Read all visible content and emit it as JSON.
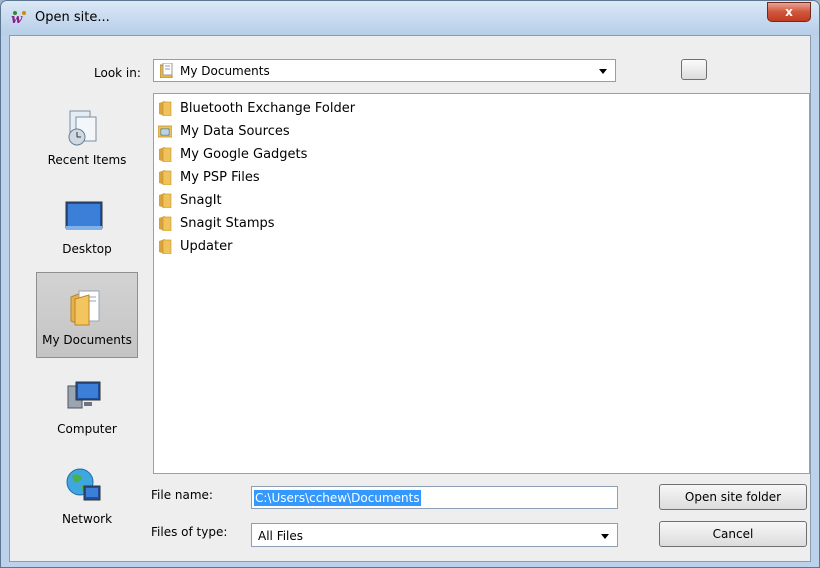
{
  "window": {
    "title": "Open site...",
    "close_symbol": "x"
  },
  "lookin": {
    "label": "Look in:",
    "value": "My Documents"
  },
  "places": [
    {
      "label": "Recent Items",
      "icon": "recent-items-icon",
      "selected": false
    },
    {
      "label": "Desktop",
      "icon": "desktop-icon",
      "selected": false
    },
    {
      "label": "My Documents",
      "icon": "my-documents-icon",
      "selected": true
    },
    {
      "label": "Computer",
      "icon": "computer-icon",
      "selected": false
    },
    {
      "label": "Network",
      "icon": "network-icon",
      "selected": false
    }
  ],
  "files": [
    {
      "name": "Bluetooth Exchange Folder",
      "icon": "folder-icon"
    },
    {
      "name": "My Data Sources",
      "icon": "data-sources-folder-icon"
    },
    {
      "name": "My Google Gadgets",
      "icon": "folder-icon"
    },
    {
      "name": "My PSP Files",
      "icon": "folder-icon"
    },
    {
      "name": "SnagIt",
      "icon": "folder-icon"
    },
    {
      "name": "Snagit Stamps",
      "icon": "folder-icon"
    },
    {
      "name": "Updater",
      "icon": "folder-icon"
    }
  ],
  "filename": {
    "label": "File name:",
    "value": "C:\\Users\\cchew\\Documents"
  },
  "filetype": {
    "label": "Files of type:",
    "value": "All Files"
  },
  "buttons": {
    "open": "Open site folder",
    "cancel": "Cancel"
  },
  "colors": {
    "selection": "#3399ff",
    "close_button": "#c23b22",
    "folder": "#e8b94a"
  }
}
